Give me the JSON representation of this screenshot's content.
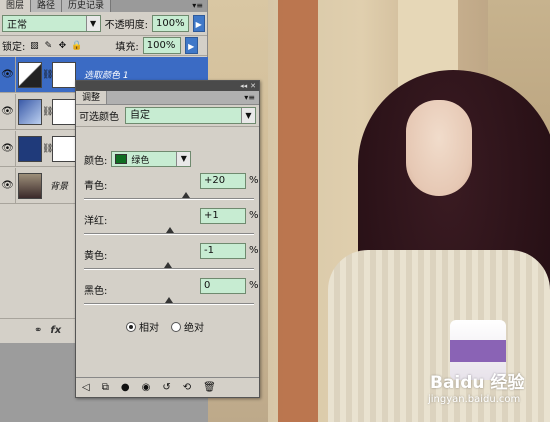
{
  "layers_panel": {
    "tabs": [
      "图层",
      "路径",
      "历史记录"
    ],
    "blend_mode": "正常",
    "opacity_label": "不透明度:",
    "opacity_value": "100%",
    "lock_label": "锁定:",
    "fill_label": "填充:",
    "fill_value": "100%",
    "layers": [
      {
        "name": "选取颜色 1",
        "selected": true
      },
      {
        "name": "",
        "selected": false
      },
      {
        "name": "",
        "selected": false
      },
      {
        "name": "背景",
        "selected": false
      }
    ]
  },
  "adjustment_panel": {
    "tab": "调整",
    "preset_label": "可选颜色",
    "preset_value": "自定",
    "color_label": "颜色:",
    "color_value": "绿色",
    "sliders": [
      {
        "label": "青色:",
        "value": "+20",
        "pos": 0.6
      },
      {
        "label": "洋红:",
        "value": "+1",
        "pos": 0.505
      },
      {
        "label": "黄色:",
        "value": "-1",
        "pos": 0.495
      },
      {
        "label": "黑色:",
        "value": "0",
        "pos": 0.5
      }
    ],
    "percent": "%",
    "radio_relative": "相对",
    "radio_absolute": "绝对"
  },
  "watermark": {
    "brand": "Baidu 经验",
    "url": "jingyan.baidu.com"
  }
}
